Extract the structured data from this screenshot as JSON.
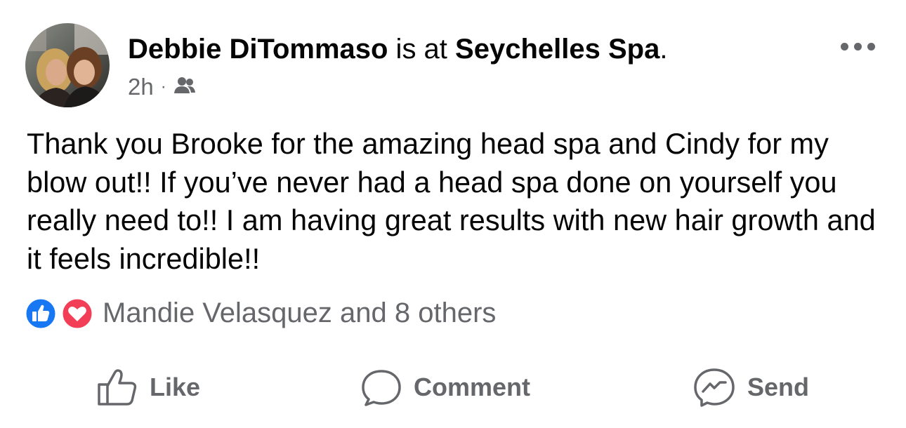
{
  "post": {
    "author": "Debbie DiTommaso",
    "connector": " is at ",
    "place": "Seychelles Spa",
    "place_suffix": ".",
    "time": "2h",
    "audience_icon": "friends-icon",
    "body": "Thank you Brooke for the amazing head spa and Cindy for my blow out!! If you’ve never had a head spa done on yourself you really need to!! I am having great results with new hair growth and it feels incredible!!",
    "reactions": {
      "icons": [
        "like-icon",
        "love-icon"
      ],
      "summary": "Mandie Velasquez and 8 others"
    },
    "actions": {
      "like": "Like",
      "comment": "Comment",
      "send": "Send"
    }
  },
  "colors": {
    "like_blue": "#1877F2",
    "love_red": "#F33E58",
    "secondary_text": "#65676B",
    "primary_text": "#050505"
  }
}
